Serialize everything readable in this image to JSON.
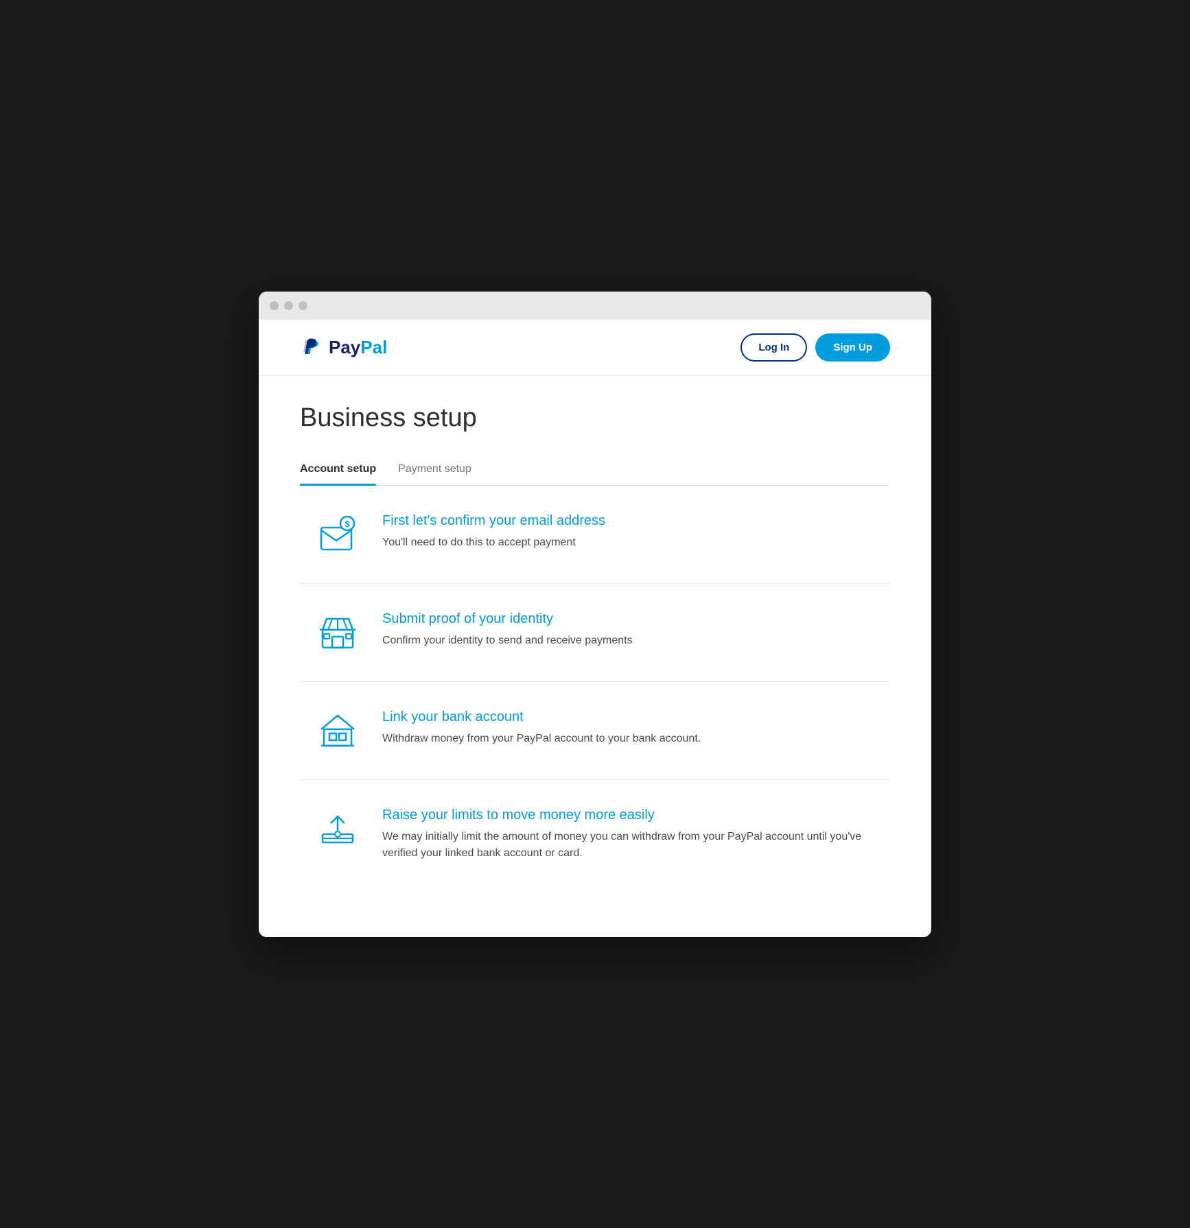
{
  "browser": {
    "traffic_lights": [
      "close",
      "minimize",
      "maximize"
    ]
  },
  "header": {
    "logo_text_pay": "Pay",
    "logo_text_pal": "Pal",
    "login_label": "Log In",
    "signup_label": "Sign Up"
  },
  "page": {
    "title": "Business setup",
    "tabs": [
      {
        "id": "account-setup",
        "label": "Account setup",
        "active": true
      },
      {
        "id": "payment-setup",
        "label": "Payment setup",
        "active": false
      }
    ],
    "setup_items": [
      {
        "id": "confirm-email",
        "icon": "email-icon",
        "title": "First let's confirm your email address",
        "description": "You'll need to do this to accept payment"
      },
      {
        "id": "submit-identity",
        "icon": "store-icon",
        "title": "Submit proof of your identity",
        "description": "Confirm your identity to send and receive payments"
      },
      {
        "id": "link-bank",
        "icon": "bank-icon",
        "title": "Link your bank account",
        "description": "Withdraw money from your PayPal account to your bank account."
      },
      {
        "id": "raise-limits",
        "icon": "upload-icon",
        "title": "Raise your limits to move money more easily",
        "description": "We may initially limit the amount of money you can withdraw from your PayPal account until you've verified your linked bank account or card."
      }
    ]
  }
}
